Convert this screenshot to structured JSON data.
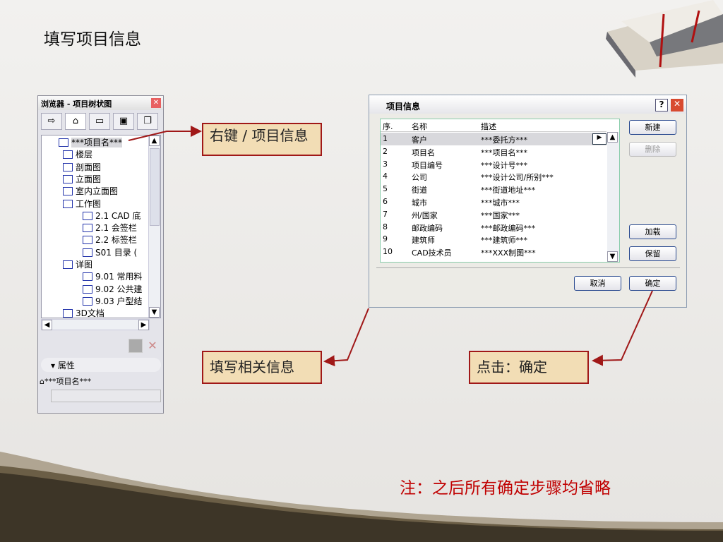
{
  "slide": {
    "title": "填写项目信息",
    "note": "注：之后所有确定步骤均省略"
  },
  "callouts": {
    "right_click": "右键 / 项目信息",
    "fill": "填写相关信息",
    "click_ok": "点击：确定"
  },
  "browser": {
    "title": "浏览器 - 项目树状图",
    "tree": [
      {
        "label": "***项目名***",
        "level": 0
      },
      {
        "label": "楼层",
        "level": 1
      },
      {
        "label": "剖面图",
        "level": 1
      },
      {
        "label": "立面图",
        "level": 1
      },
      {
        "label": "室内立面图",
        "level": 1
      },
      {
        "label": "工作图",
        "level": 1
      },
      {
        "label": "2.1 CAD 底",
        "level": 2
      },
      {
        "label": "2.1 会签栏",
        "level": 2
      },
      {
        "label": "2.2 标签栏",
        "level": 2
      },
      {
        "label": "S01 目录 (",
        "level": 2
      },
      {
        "label": "详图",
        "level": 1
      },
      {
        "label": "9.01 常用料",
        "level": 2
      },
      {
        "label": "9.02 公共建",
        "level": 2
      },
      {
        "label": "9.03 户型结",
        "level": 2
      },
      {
        "label": "3D文档",
        "level": 1
      }
    ],
    "properties_label": "属性",
    "project_name": "***项目名***"
  },
  "dialog": {
    "title": "项目信息",
    "columns": [
      "序.",
      "名称",
      "描述"
    ],
    "rows": [
      [
        "1",
        "客户",
        "***委托方***"
      ],
      [
        "2",
        "项目名",
        "***项目名***"
      ],
      [
        "3",
        "项目编号",
        "***设计号***"
      ],
      [
        "4",
        "公司",
        "***设计公司/所别***"
      ],
      [
        "5",
        "街道",
        "***街道地址***"
      ],
      [
        "6",
        "城市",
        "***城市***"
      ],
      [
        "7",
        "州/国家",
        "***国家***"
      ],
      [
        "8",
        "邮政编码",
        "***邮政编码***"
      ],
      [
        "9",
        "建筑师",
        "***建筑师***"
      ],
      [
        "10",
        "CAD技术员",
        "***XXX制图***"
      ]
    ],
    "buttons": {
      "new": "新建",
      "delete": "删除",
      "load": "加载",
      "save": "保留",
      "cancel": "取消",
      "ok": "确定"
    }
  }
}
